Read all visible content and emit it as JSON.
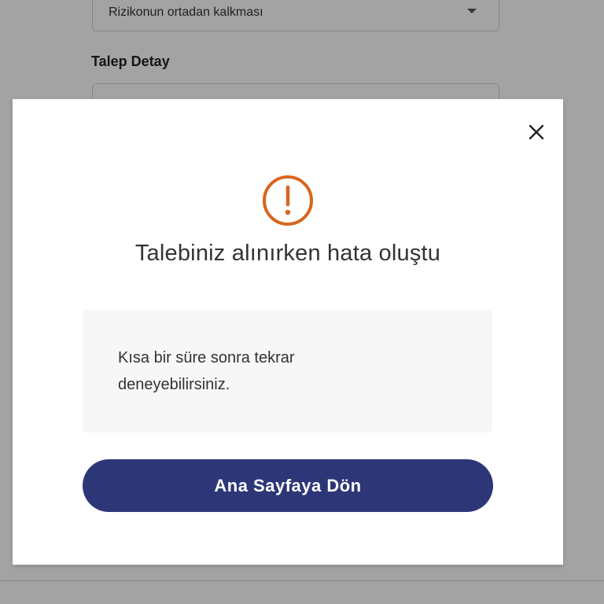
{
  "background_form": {
    "select_value": "Rizikonun ortadan kalkması",
    "detail_label": "Talep Detay"
  },
  "modal": {
    "title": "Talebiniz alınırken hata oluştu",
    "message": "Kısa bir süre sonra tekrar deneyebilirsiniz.",
    "primary_button_label": "Ana Sayfaya Dön",
    "icons": {
      "close": "close-icon",
      "warning": "exclamation-circle-icon"
    },
    "colors": {
      "accent_warning": "#d9661f",
      "primary_button": "#2d3778"
    }
  }
}
